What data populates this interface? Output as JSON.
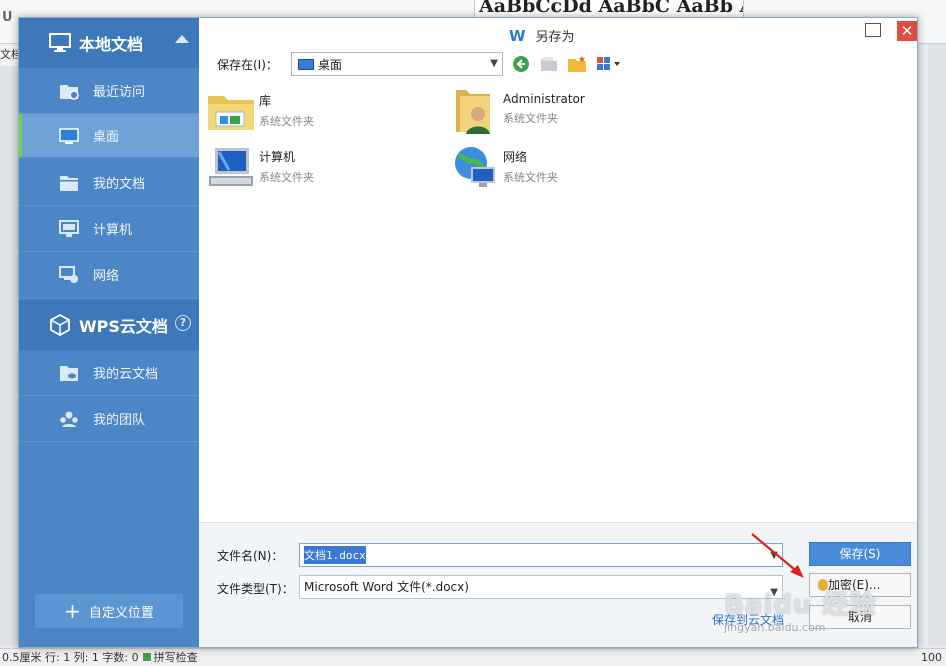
{
  "background_app": {
    "style_preview": "AaBbCcDd AaBbC AaBb AaBbC",
    "toolbar_glyph_u": "U",
    "ruler_text": "文档",
    "status_text": "0.5厘米 行: 1  列: 1  字数: 0",
    "status_check": "拼写检查",
    "zoom": "100"
  },
  "dialog": {
    "title": "另存为",
    "title_icon": "W",
    "close_icon": "close-icon",
    "maximize_icon": "maximize-icon"
  },
  "sidebar": {
    "local_header": "本地文档",
    "local_items": [
      {
        "label": "最近访问",
        "icon": "recent-folder-icon"
      },
      {
        "label": "桌面",
        "icon": "desktop-icon"
      },
      {
        "label": "我的文档",
        "icon": "documents-folder-icon"
      },
      {
        "label": "计算机",
        "icon": "computer-icon"
      },
      {
        "label": "网络",
        "icon": "network-icon"
      }
    ],
    "cloud_header": "WPS云文档",
    "cloud_help": "?",
    "cloud_items": [
      {
        "label": "我的云文档",
        "icon": "cloud-folder-icon"
      },
      {
        "label": "我的团队",
        "icon": "team-icon"
      }
    ],
    "custom_location": "自定义位置",
    "active_item": "桌面"
  },
  "location_bar": {
    "label": "保存在(I)：",
    "current": "桌面"
  },
  "files": [
    {
      "name": "库",
      "subtitle": "系统文件夹",
      "icon": "library-icon"
    },
    {
      "name": "Administrator",
      "subtitle": "系统文件夹",
      "icon": "user-folder-icon"
    },
    {
      "name": "计算机",
      "subtitle": "系统文件夹",
      "icon": "computer-icon"
    },
    {
      "name": "网络",
      "subtitle": "系统文件夹",
      "icon": "network-globe-icon"
    }
  ],
  "form": {
    "filename_label": "文件名(N)：",
    "filename_value": "文档1.docx",
    "filetype_label": "文件类型(T)：",
    "filetype_value": "Microsoft Word 文件(*.docx)",
    "save_button": "保存(S)",
    "encrypt_button": "加密(E)...",
    "cancel_button": "取消",
    "cloud_save_link": "保存到云文档"
  },
  "watermark": {
    "brand": "Baidu 经验",
    "url": "jingyan.baidu.com"
  },
  "colors": {
    "sidebar": "#4d86c7",
    "sidebar_header": "#3e78bb",
    "active_indicator": "#7cd33c",
    "primary_button": "#4a8bd8",
    "close_button": "#e04c3f"
  }
}
